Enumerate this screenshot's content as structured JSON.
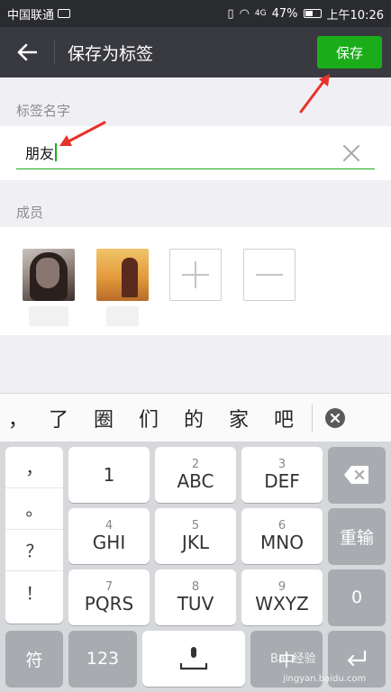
{
  "status_bar": {
    "carrier": "中国联通",
    "signal": "4G",
    "battery": "47%",
    "time": "上午10:26"
  },
  "header": {
    "title": "保存为标签",
    "save_label": "保存"
  },
  "tag_name": {
    "label": "标签名字",
    "value": "朋友"
  },
  "members": {
    "label": "成员"
  },
  "candidates": {
    "comma": "，",
    "words": [
      "了",
      "圈",
      "们",
      "的",
      "家",
      "吧"
    ]
  },
  "keyboard": {
    "punctuation": [
      "，",
      "。",
      "？",
      "！"
    ],
    "keys": [
      {
        "num": "",
        "letters": "1"
      },
      {
        "num": "2",
        "letters": "ABC"
      },
      {
        "num": "3",
        "letters": "DEF"
      },
      {
        "num": "4",
        "letters": "GHI"
      },
      {
        "num": "5",
        "letters": "JKL"
      },
      {
        "num": "6",
        "letters": "MNO"
      },
      {
        "num": "7",
        "letters": "PQRS"
      },
      {
        "num": "8",
        "letters": "TUV"
      },
      {
        "num": "9",
        "letters": "WXYZ"
      }
    ],
    "reenter": "重输",
    "zero": "0",
    "symbol": "符",
    "num_switch": "123",
    "lang": "中"
  },
  "watermark": {
    "brand": "Bai 经验",
    "url": "jingyan.baidu.com"
  },
  "colors": {
    "accent": "#1aad19",
    "navbar": "#393a3f",
    "arrow": "#e8322a"
  }
}
